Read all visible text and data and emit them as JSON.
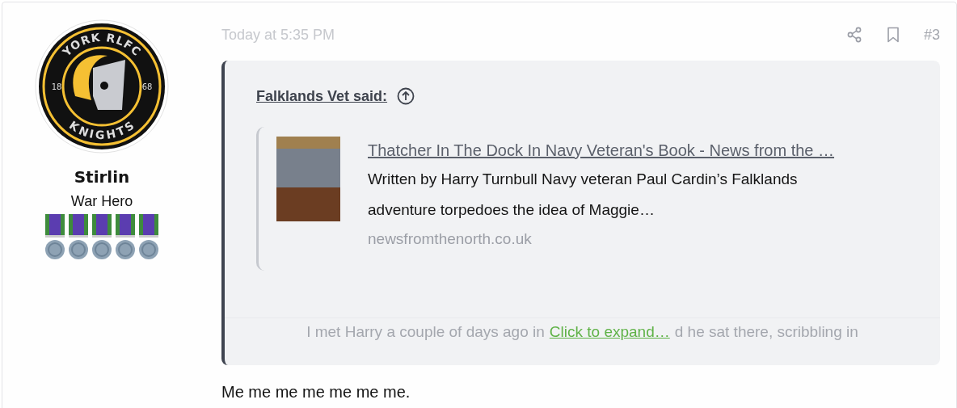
{
  "author": {
    "avatar": {
      "top_text": "YORK RLFC",
      "left_text": "18",
      "right_text": "68",
      "bottom_text": "KNIGHTS"
    },
    "username": "Stirlin",
    "title": "War Hero"
  },
  "post": {
    "time": "Today at 5:35 PM",
    "number": "#3",
    "quote": {
      "attribution": "Falklands Vet said:",
      "embed": {
        "title": "Thatcher In The Dock In Navy Veteran's Book - News from the …",
        "description": "Written by Harry Turnbull Navy veteran Paul Cardin’s Falklands adventure torpedoes the idea of Maggie…",
        "domain": "newsfromthenorth.co.uk"
      },
      "faded_left": "I met Harry a couple of days ago in",
      "faded_right": "d he sat there, scribbling in",
      "expand": "Click to expand…"
    },
    "body": "Me me me me me me me."
  }
}
